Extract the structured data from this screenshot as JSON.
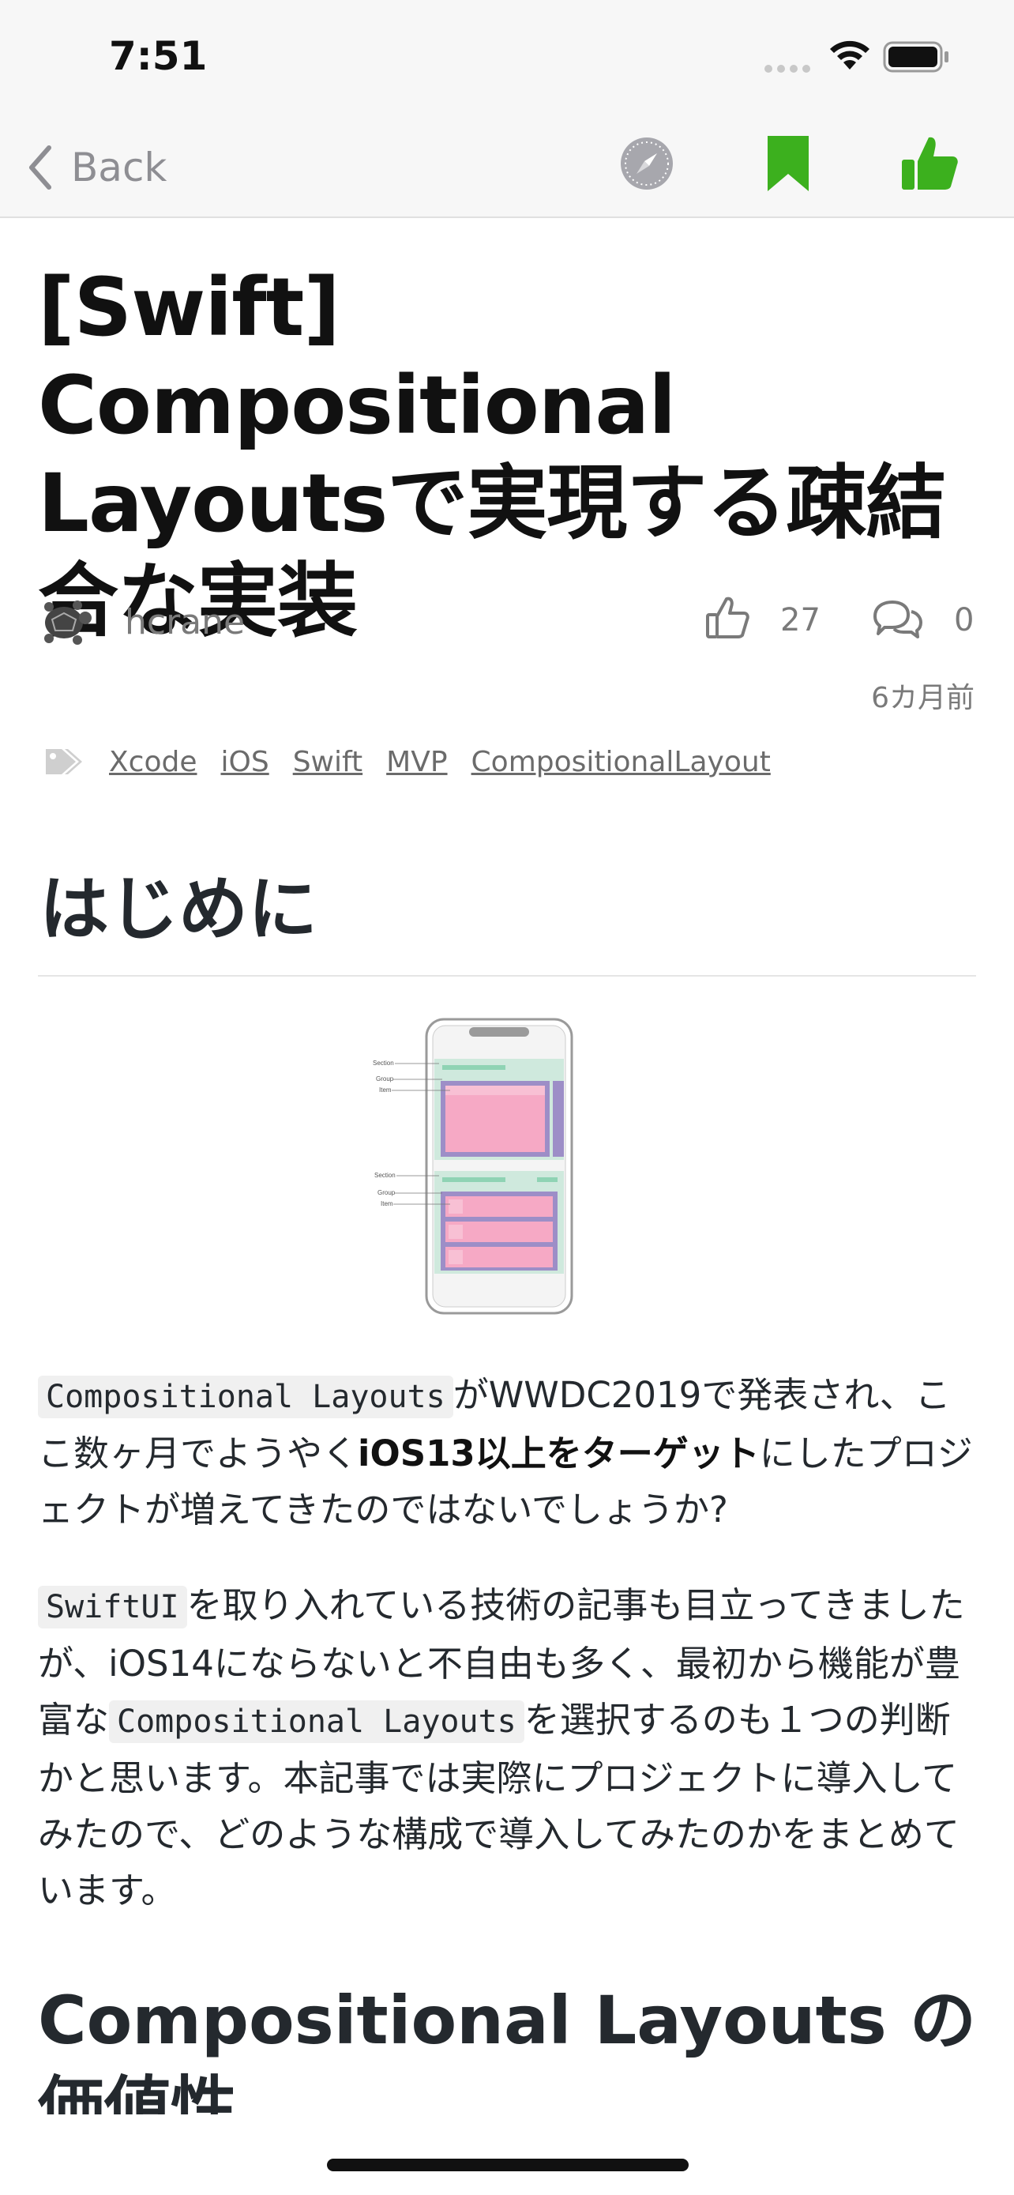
{
  "status": {
    "time": "7:51"
  },
  "nav": {
    "back_label": "Back",
    "bookmark_color": "#3cb01e",
    "thumbs_color": "#3cb01e"
  },
  "article": {
    "title": "[Swift] Compositional Layoutsで実現する疎結合な実装",
    "author": "hcrane",
    "likes": "27",
    "comments": "0",
    "date": "6カ月前",
    "tags": [
      "Xcode",
      "iOS",
      "Swift",
      "MVP",
      "CompositionalLayout"
    ],
    "h1": "はじめに",
    "figure_labels": {
      "section_a": "Section",
      "group_a": "Group",
      "item_a": "Item",
      "section_b": "Section",
      "group_b": "Group",
      "item_b": "Item"
    },
    "p1": {
      "code1": "Compositional Layouts",
      "t1": "がWWDC2019で発表され、ここ数ヶ月でようやく",
      "bold": "iOS13以上をターゲット",
      "t2": "にしたプロジェクトが増えてきたのではないでしょうか?"
    },
    "p2": {
      "code1": "SwiftUI",
      "t1": "を取り入れている技術の記事も目立ってきましたが、iOS14にならないと不自由も多く、最初から機能が豊富な",
      "code2": "Compositional Layouts",
      "t2": "を選択するのも１つの判断かと思います。本記事では実際にプロジェクトに導入してみたので、どのような構成で導入してみたのかをまとめています。"
    },
    "h2": "Compositional Layouts の価値性"
  }
}
